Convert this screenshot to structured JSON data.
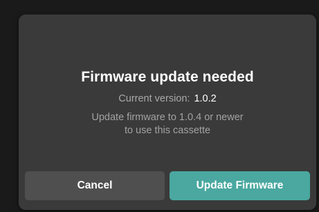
{
  "dialog": {
    "title": "Firmware update needed",
    "current_version_label": "Current version:",
    "current_version_value": "1.0.2",
    "message": "Update firmware to 1.0.4 or newer to use this cassette",
    "cancel_label": "Cancel",
    "update_label": "Update Firmware"
  },
  "colors": {
    "dialog_background": "#3a3a3a",
    "cancel_button": "#4f4f4f",
    "update_button": "#4aa8a0"
  }
}
